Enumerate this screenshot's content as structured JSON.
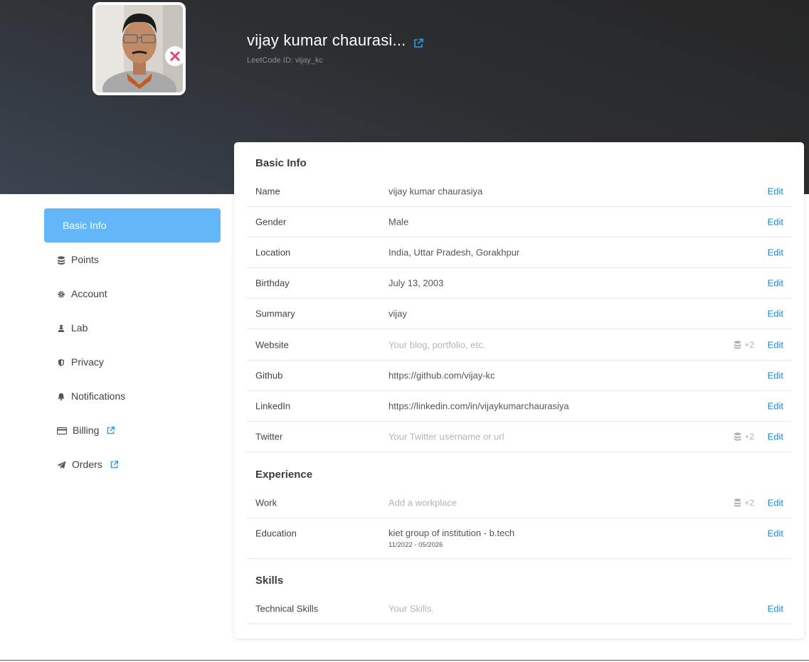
{
  "header": {
    "display_name": "vijay kumar chaurasi...",
    "leetcode_id": "LeetCode ID: vijay_kc"
  },
  "sidebar": {
    "items": [
      {
        "label": "Basic Info",
        "icon": "none",
        "active": true
      },
      {
        "label": "Points",
        "icon": "database-icon"
      },
      {
        "label": "Account",
        "icon": "gear-icon"
      },
      {
        "label": "Lab",
        "icon": "flask-icon"
      },
      {
        "label": "Privacy",
        "icon": "shield-icon"
      },
      {
        "label": "Notifications",
        "icon": "bell-icon"
      },
      {
        "label": "Billing",
        "icon": "credit-card-icon",
        "external": true
      },
      {
        "label": "Orders",
        "icon": "paper-plane-icon",
        "external": true
      }
    ]
  },
  "sections": {
    "basic_info": {
      "title": "Basic Info",
      "rows": [
        {
          "label": "Name",
          "value": "vijay kumar chaurasiya",
          "edit": "Edit"
        },
        {
          "label": "Gender",
          "value": "Male",
          "edit": "Edit"
        },
        {
          "label": "Location",
          "value": "India, Uttar Pradesh, Gorakhpur",
          "edit": "Edit"
        },
        {
          "label": "Birthday",
          "value": "July 13, 2003",
          "edit": "Edit"
        },
        {
          "label": "Summary",
          "value": "vijay",
          "edit": "Edit"
        },
        {
          "label": "Website",
          "placeholder": "Your blog, portfolio, etc.",
          "points": "+2",
          "edit": "Edit"
        },
        {
          "label": "Github",
          "value": "https://github.com/vijay-kc",
          "edit": "Edit"
        },
        {
          "label": "LinkedIn",
          "value": "https://linkedin.com/in/vijaykumarchaurasiya",
          "edit": "Edit"
        },
        {
          "label": "Twitter",
          "placeholder": "Your Twitter username or url",
          "points": "+2",
          "edit": "Edit"
        }
      ]
    },
    "experience": {
      "title": "Experience",
      "rows": [
        {
          "label": "Work",
          "placeholder": "Add a workplace",
          "points": "+2",
          "edit": "Edit"
        },
        {
          "label": "Education",
          "value": "kiet group of institution - b.tech",
          "sub": "11/2022 - 05/2026",
          "edit": "Edit"
        }
      ]
    },
    "skills": {
      "title": "Skills",
      "rows": [
        {
          "label": "Technical Skills",
          "placeholder": "Your Skills.",
          "edit": "Edit"
        }
      ]
    }
  },
  "colors": {
    "accent": "#63b6f7",
    "link": "#1d8ace",
    "hero_dark": "#262626",
    "hero_light": "#3b4450"
  }
}
